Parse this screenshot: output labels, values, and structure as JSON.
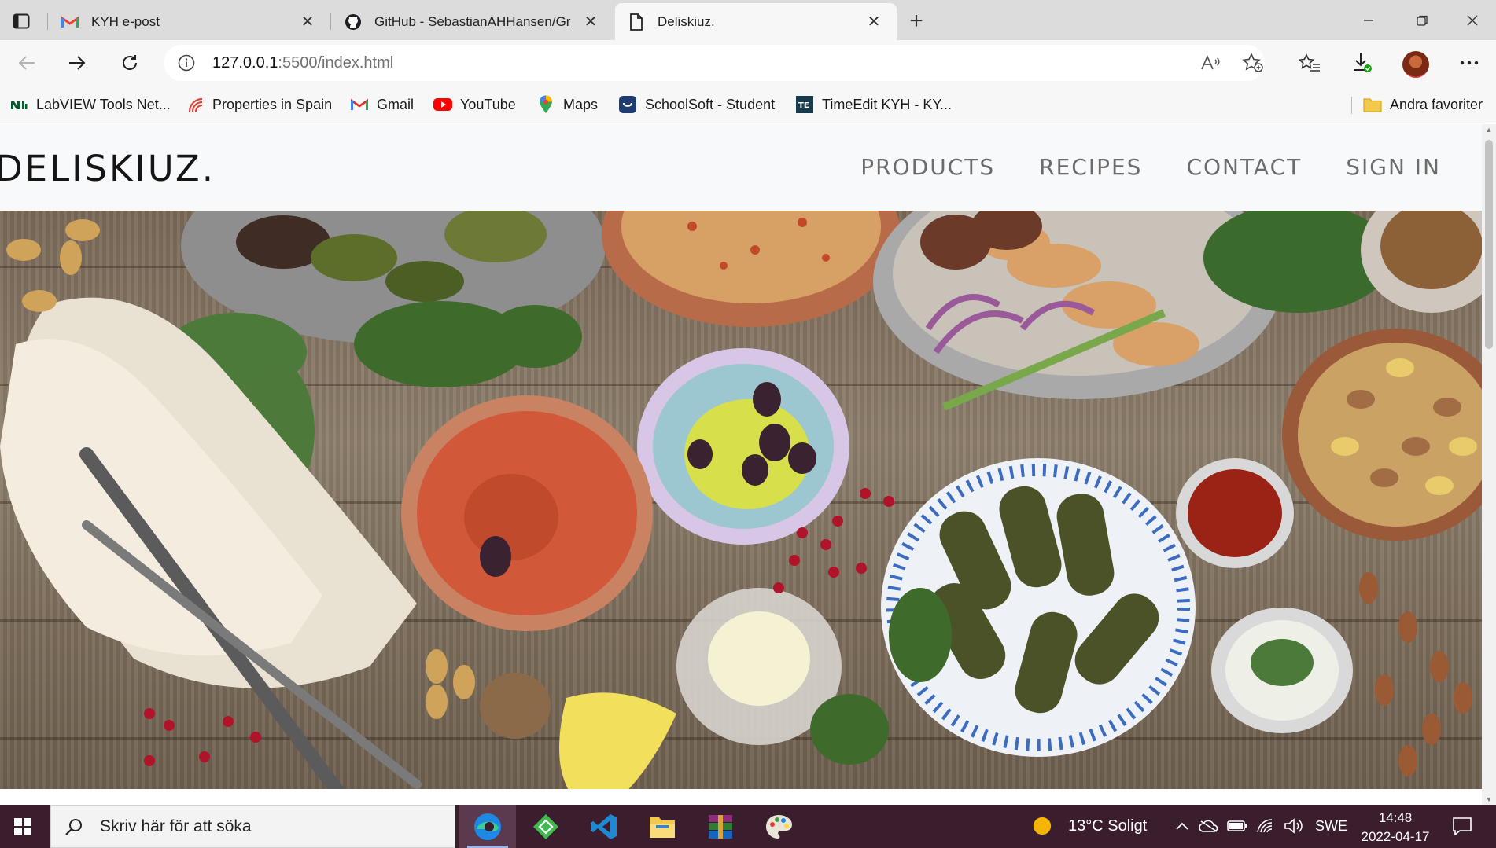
{
  "browser": {
    "tabs": [
      {
        "title": "KYH e-post",
        "icon": "gmail-icon",
        "active": false
      },
      {
        "title": "GitHub - SebastianAHHansen/Gr",
        "icon": "github-icon",
        "active": false
      },
      {
        "title": "Deliskiuz.",
        "icon": "page-icon",
        "active": true
      }
    ],
    "url_host": "127.0.0.1",
    "url_path": ":5500/index.html",
    "bookmarks": [
      {
        "label": "LabVIEW Tools Net...",
        "icon": "labview-icon"
      },
      {
        "label": "Properties in Spain",
        "icon": "properties-icon"
      },
      {
        "label": "Gmail",
        "icon": "gmail-icon"
      },
      {
        "label": "YouTube",
        "icon": "youtube-icon"
      },
      {
        "label": "Maps",
        "icon": "maps-pin-icon"
      },
      {
        "label": "SchoolSoft - Student",
        "icon": "schoolsoft-icon"
      },
      {
        "label": "TimeEdit KYH - KY...",
        "icon": "timeedit-icon"
      }
    ],
    "other_favorites": "Andra favoriter",
    "colors": {
      "tabstrip": "#dcdcdc",
      "toolbar": "#f7f7f7",
      "accent": "#0f6cbd"
    }
  },
  "site": {
    "logo": "DELISKIUZ.",
    "nav": [
      "PRODUCTS",
      "RECIPES",
      "CONTACT",
      "SIGN IN"
    ],
    "hero_alt": "Mediterranean food spread on a wooden table"
  },
  "taskbar": {
    "search_placeholder": "Skriv här för att söka",
    "weather": "13°C  Soligt",
    "language": "SWE",
    "time": "14:48",
    "date": "2022-04-17",
    "colors": {
      "bar": "#3a1e2e"
    }
  }
}
